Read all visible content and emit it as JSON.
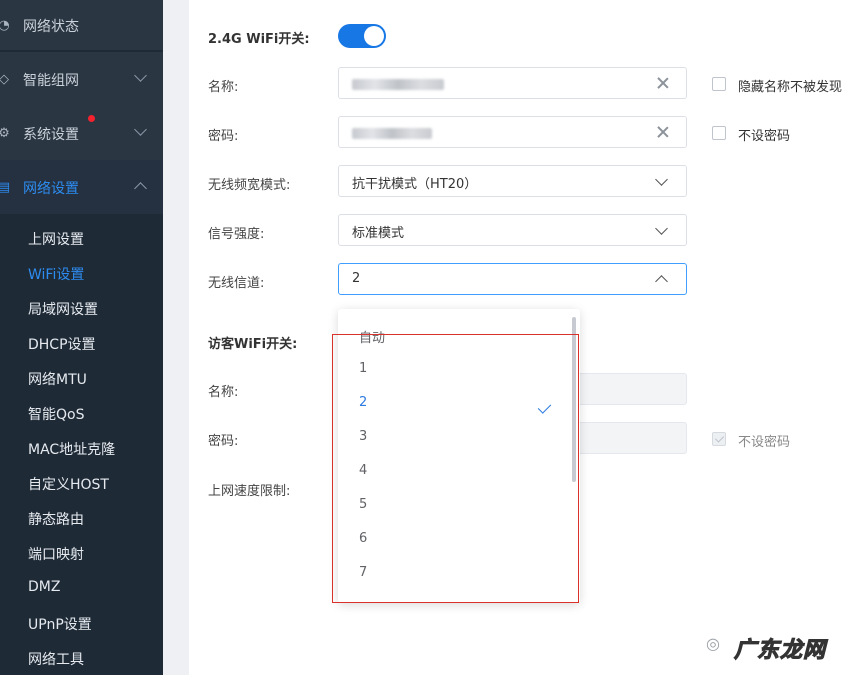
{
  "sidebar": {
    "top_items": [
      {
        "label": "网络状态",
        "icon": "status-icon"
      },
      {
        "label": "智能组网",
        "icon": "mesh-icon"
      },
      {
        "label": "系统设置",
        "icon": "gear-icon",
        "badge": true
      },
      {
        "label": "网络设置",
        "icon": "network-icon"
      }
    ],
    "sub_items": [
      {
        "label": "上网设置"
      },
      {
        "label": "WiFi设置"
      },
      {
        "label": "局域网设置"
      },
      {
        "label": "DHCP设置"
      },
      {
        "label": "网络MTU"
      },
      {
        "label": "智能QoS"
      },
      {
        "label": "MAC地址克隆"
      },
      {
        "label": "自定义HOST"
      },
      {
        "label": "静态路由"
      },
      {
        "label": "端口映射"
      },
      {
        "label": "DMZ"
      },
      {
        "label": "UPnP设置"
      },
      {
        "label": "网络工具"
      }
    ],
    "active_sub": "WiFi设置"
  },
  "form": {
    "wifi24_switch_label": "2.4G WiFi开关:",
    "wifi24_switch_on": true,
    "name_label": "名称:",
    "name_value_hidden": true,
    "hide_ssid_label": "隐藏名称不被发现",
    "password_label": "密码:",
    "password_value_hidden": true,
    "no_password_label": "不设密码",
    "bandwidth_label": "无线频宽模式:",
    "bandwidth_value": "抗干扰模式（HT20）",
    "signal_label": "信号强度:",
    "signal_value": "标准模式",
    "channel_label": "无线信道:",
    "channel_value": "2",
    "guest_switch_label": "访客WiFi开关:",
    "guest_name_label": "名称:",
    "guest_password_label": "密码:",
    "guest_no_password_label": "不设密码",
    "speed_limit_label": "上网速度限制:"
  },
  "channel_dropdown": {
    "options": [
      "自动",
      "1",
      "2",
      "3",
      "4",
      "5",
      "6",
      "7"
    ],
    "selected": "2"
  },
  "watermark": {
    "text": "广东龙网"
  },
  "colors": {
    "accent": "#2d8cf0",
    "toggle_on": "#1677e5",
    "sidebar_bg": "#1f2a37",
    "highlight_box": "#d9322b",
    "badge": "#f5222d"
  }
}
